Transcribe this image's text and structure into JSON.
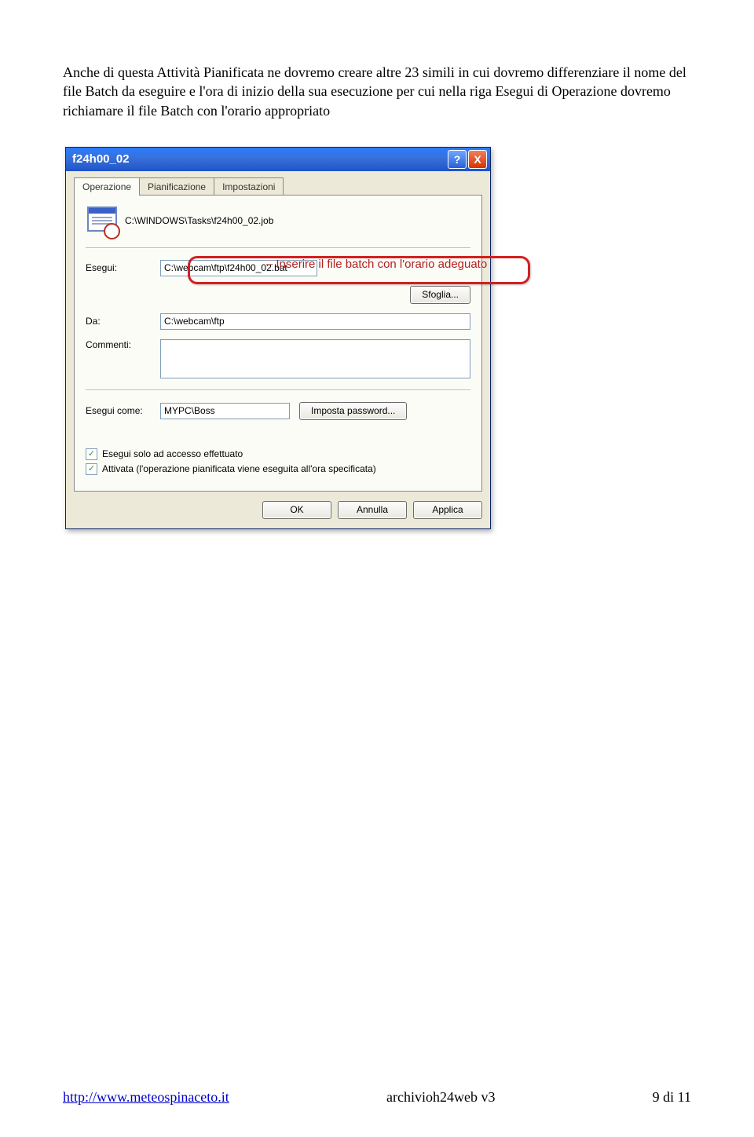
{
  "intro": {
    "p1": "Anche di questa Attività Pianificata ne dovremo creare altre 23 simili in cui dovremo differenziare il nome del file Batch da eseguire e l'ora di inizio della sua esecuzione per cui nella riga Esegui di Operazione dovremo richiamare il file Batch con l'orario appropriato"
  },
  "dialog": {
    "title": "f24h00_02",
    "tabs": {
      "t1": "Operazione",
      "t2": "Pianificazione",
      "t3": "Impostazioni"
    },
    "job_path": "C:\\WINDOWS\\Tasks\\f24h00_02.job",
    "labels": {
      "esegui": "Esegui:",
      "da": "Da:",
      "commenti": "Commenti:",
      "esegui_come": "Esegui come:"
    },
    "fields": {
      "esegui": "C:\\webcam\\ftp\\f24h00_02.bat",
      "da": "C:\\webcam\\ftp",
      "esegui_come": "MYPC\\Boss"
    },
    "buttons": {
      "sfoglia": "Sfoglia...",
      "imposta_pw": "Imposta password...",
      "ok": "OK",
      "annulla": "Annulla",
      "applica": "Applica"
    },
    "checks": {
      "c1": "Esegui solo ad accesso effettuato",
      "c2": "Attivata (l'operazione pianificata viene eseguita all'ora specificata)"
    }
  },
  "annotation": "Inserire il file batch con l'orario adeguato",
  "footer": {
    "url": "http://www.meteospinaceto.it",
    "center": "archivioh24web v3",
    "right": "9 di 11"
  }
}
